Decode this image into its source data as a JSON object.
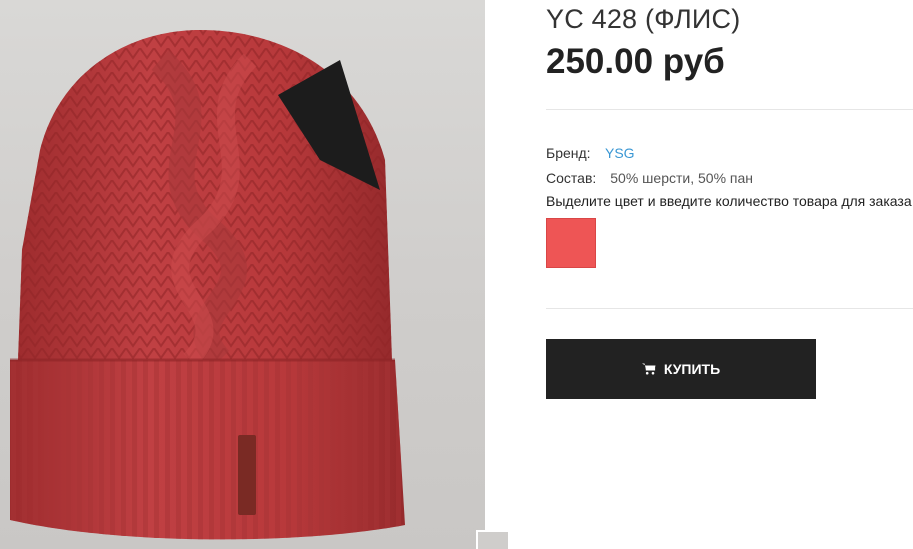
{
  "product": {
    "title": "YC 428 (ФЛИС)",
    "price": "250.00 руб",
    "photo_alt": "YC 428 (ФЛИС)"
  },
  "details": {
    "brand_label": "Бренд:",
    "brand_value": "YSG",
    "composition_label": "Состав:",
    "composition_value": "50% шерсти, 50% пан",
    "hint": "Выделите цвет и введите количество товара для заказа"
  },
  "colors": {
    "swatch": "#ee5555"
  },
  "actions": {
    "buy_label": "КУПИТЬ",
    "buy_icon": "cart-icon"
  }
}
